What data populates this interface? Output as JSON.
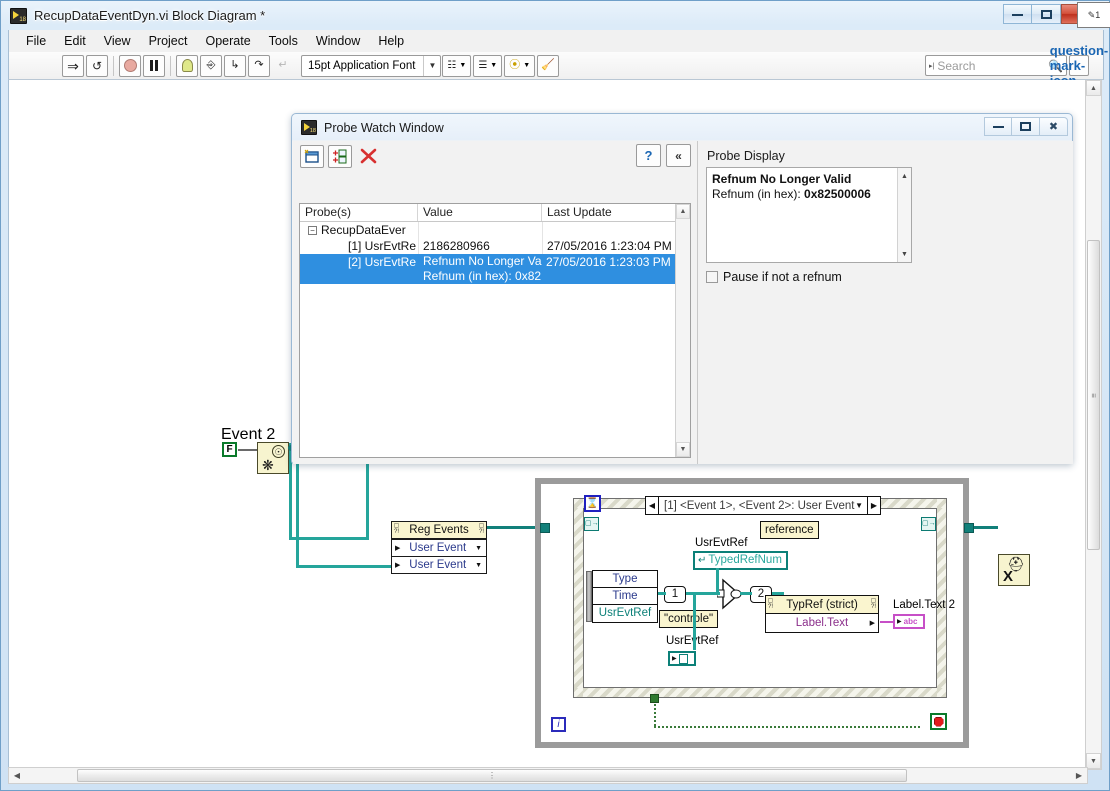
{
  "window": {
    "title": "RecupDataEventDyn.vi Block Diagram *",
    "icon": "labview-vi-icon",
    "buttons": {
      "minimize": "minimize-icon",
      "maximize": "maximize-icon",
      "close": "✕"
    }
  },
  "menubar": {
    "items": [
      "File",
      "Edit",
      "View",
      "Project",
      "Operate",
      "Tools",
      "Window",
      "Help"
    ]
  },
  "toolbar": {
    "run": "run-arrow-icon",
    "run_continuous": "run-continuously-icon",
    "abort": "abort-execution-icon",
    "pause": "pause-icon",
    "highlight": "highlight-execution-bulb-icon",
    "retain_values": "retain-wire-values-icon",
    "step_into": "step-into-icon",
    "step_over": "step-over-icon",
    "step_out": "step-out-icon",
    "font": "15pt Application Font",
    "align_objects": "align-objects-icon",
    "distribute_objects": "distribute-objects-icon",
    "reorder": "reorder-icon",
    "clean_diagram": "clean-up-diagram-icon",
    "search_placeholder": "Search",
    "search_icon": "magnifier-icon",
    "help_icon": "question-mark-icon",
    "context_help": "context-help-icon"
  },
  "probe_window": {
    "title": "Probe Watch Window",
    "icon": "labview-vi-icon",
    "buttons": {
      "minimize": "minimize-icon",
      "maximize": "maximize-icon",
      "close": "close-x-icon"
    },
    "toolbar": {
      "new_probe": "new-probe-icon",
      "add_probe": "add-probe-icon",
      "delete_probe": "delete-probe-x-icon",
      "help": "?",
      "collapse": "«"
    },
    "table": {
      "headers": [
        "Probe(s)",
        "Value",
        "Last Update"
      ],
      "sort_arrow": "sort-ascending-icon",
      "rows": [
        {
          "indent": 0,
          "expander": "−",
          "probe": "RecupDataEver",
          "value": "",
          "last_update": "",
          "selected": false
        },
        {
          "indent": 1,
          "expander": "",
          "probe": "[1] UsrEvtRe",
          "value": "2186280966",
          "last_update": "27/05/2016 1:23:04 PM",
          "selected": false
        },
        {
          "indent": 1,
          "expander": "",
          "probe": "[2] UsrEvtRe",
          "value": "Refnum No Longer Va",
          "value2": "Refnum (in hex): 0x82",
          "last_update": "27/05/2016 1:23:03 PM",
          "selected": true
        }
      ]
    },
    "display": {
      "label": "Probe Display",
      "line1": "Refnum No Longer Valid",
      "line2_prefix": "Refnum (in hex): ",
      "line2_value": "0x82500006",
      "checkbox_label": "Pause if not a refnum",
      "checkbox_checked": false
    }
  },
  "diagram": {
    "event2_label": "Event 2",
    "bool_constant": "F",
    "create_user_event_icon": "create-user-event-icon",
    "reg_events": {
      "title": "Reg Events",
      "rows": [
        "User Event",
        "User Event"
      ]
    },
    "event_structure": {
      "case_selector": "[1] <Event 1>, <Event 2>: User Event",
      "timeout_icon": "hourglass-timeout-icon",
      "event_data_node": [
        "Type",
        "Time",
        "UsrEvtRef"
      ]
    },
    "usr_evt_ref_label_top": "UsrEvtRef",
    "reference_label": "reference",
    "typed_refnum": "TypedRefNum",
    "const_1": "1",
    "const_2": "2",
    "string_constant": "\"controle\"",
    "usr_evt_ref_label_bottom": "UsrEvtRef",
    "property_node": {
      "title": "TypRef (strict)",
      "property": "Label.Text"
    },
    "label_text2": "Label.Text 2",
    "string_indicator": "abc",
    "unregister_icon": "unregister-for-events-icon",
    "loop_iteration": "i",
    "loop_stop": "stop-button-icon"
  },
  "scrollbars": {
    "vertical": {
      "up": "▲",
      "down": "▼",
      "grip": "grip-icon"
    },
    "horizontal": {
      "left": "◀",
      "right": "▶",
      "grip": "grip-icon"
    }
  },
  "colors": {
    "refnum_wire": "#25a59b",
    "selection_blue": "#2f8fe0",
    "node_yellow": "#faf5cf",
    "property_magenta": "#8b2f8b",
    "terminal_teal": "#0c8078"
  }
}
